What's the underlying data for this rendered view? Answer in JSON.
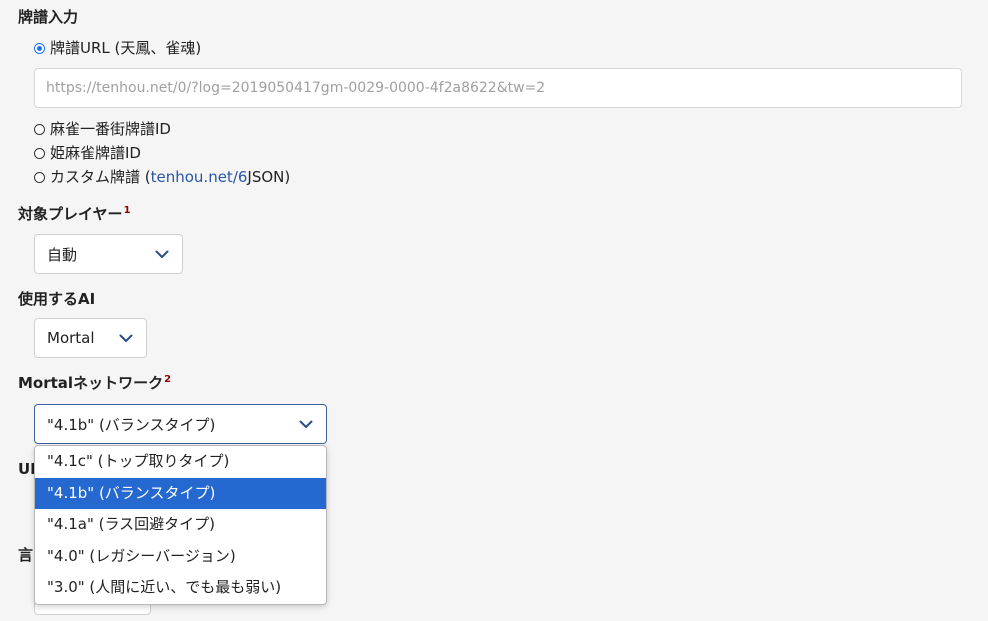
{
  "kifu_section": {
    "title": "牌譜入力",
    "options": [
      {
        "label": "牌譜URL (天鳳、雀魂)",
        "checked": true
      },
      {
        "label": "麻雀一番街牌譜ID",
        "checked": false
      },
      {
        "label": "姫麻雀牌譜ID",
        "checked": false
      }
    ],
    "custom_option": {
      "label_prefix": "カスタム牌譜 (",
      "link_text": "tenhou.net/6",
      "label_suffix": " JSON)",
      "checked": false
    },
    "url_placeholder": "https://tenhou.net/0/?log=2019050417gm-0029-0000-4f2a8622&tw=2"
  },
  "player_section": {
    "title": "対象プレイヤー",
    "footnote": "1",
    "selected": "自動"
  },
  "ai_section": {
    "title": "使用するAI",
    "selected": "Mortal"
  },
  "network_section": {
    "title": "Mortalネットワーク",
    "footnote": "2",
    "selected": "\"4.1b\" (バランスタイプ)",
    "options": [
      "\"4.1c\" (トップ取りタイプ)",
      "\"4.1b\" (バランスタイプ)",
      "\"4.1a\" (ラス回避タイプ)",
      "\"4.0\" (レガシーバージョン)",
      "\"3.0\" (人間に近い、でも最も弱い)"
    ],
    "highlighted_index": 1
  },
  "hidden_partial": {
    "ui_heading_fragment": "UI",
    "language_heading_fragment": "言"
  },
  "colors": {
    "accent": "#2468d0",
    "footnote": "#8b0000",
    "link": "#2a55a5"
  }
}
